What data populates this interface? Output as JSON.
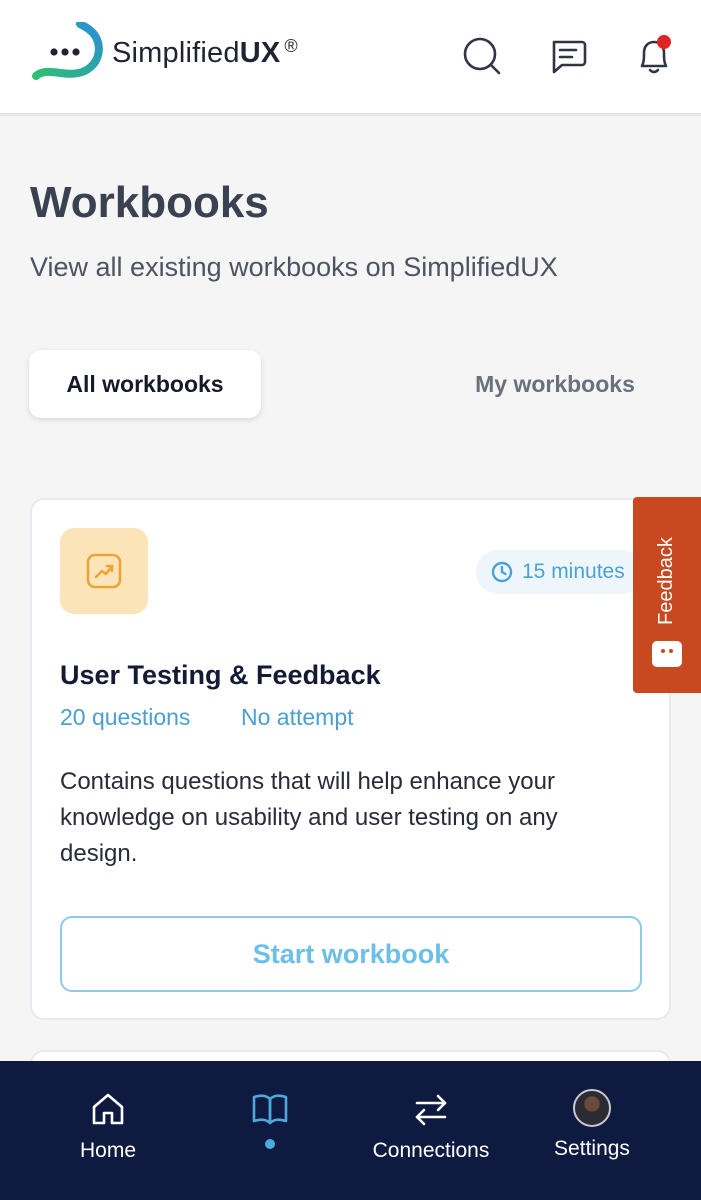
{
  "app": {
    "logo_text_regular": "Simplified",
    "logo_text_bold": "UX",
    "logo_registered": "®"
  },
  "header": {
    "icons": [
      "search-icon",
      "chat-icon",
      "bell-icon"
    ],
    "notification_dot_color": "#e02424"
  },
  "page": {
    "title": "Workbooks",
    "subtitle": "View all existing workbooks on SimplifiedUX"
  },
  "tabs": [
    {
      "label": "All workbooks",
      "active": true
    },
    {
      "label": "My workbooks",
      "active": false
    }
  ],
  "card": {
    "icon": "trending-up-icon",
    "duration": "15 minutes",
    "title": "User Testing & Feedback",
    "questions": "20 questions",
    "attempt_status": "No attempt",
    "description": "Contains questions that will help enhance your knowledge on usability and user testing on any design.",
    "button_label": "Start workbook"
  },
  "feedback_tab": {
    "label": "Feedback",
    "color": "#c8491f"
  },
  "bottom_nav": {
    "items": [
      {
        "label": "Home",
        "icon": "home-icon"
      },
      {
        "label": "",
        "icon": "book-icon",
        "active": true
      },
      {
        "label": "Connections",
        "icon": "swap-arrows-icon"
      },
      {
        "label": "Settings",
        "icon": "avatar"
      }
    ],
    "background": "#0f1a40",
    "active_indicator_color": "#4fa7e0"
  },
  "colors": {
    "accent_blue": "#4b9fd0",
    "title_dark": "#141a33",
    "icon_tile_bg": "#fbe5b8"
  }
}
